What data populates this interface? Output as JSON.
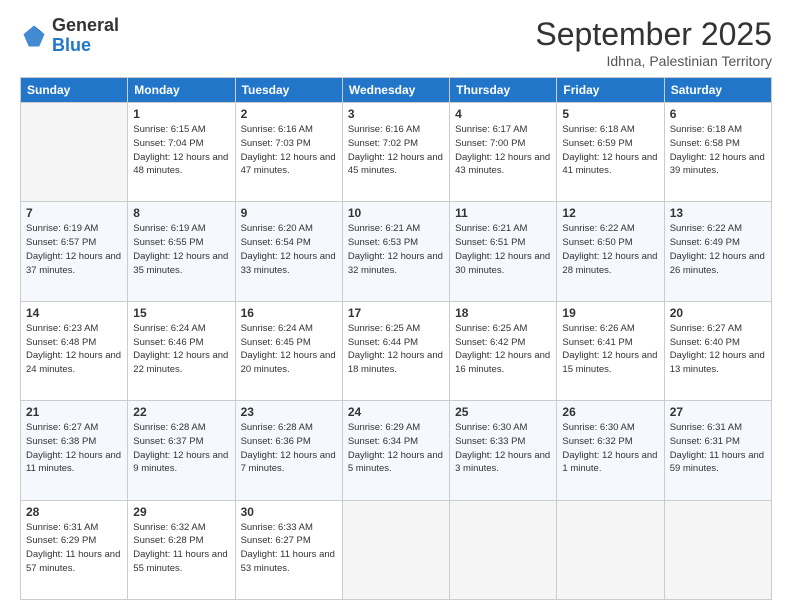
{
  "header": {
    "logo_general": "General",
    "logo_blue": "Blue",
    "month_title": "September 2025",
    "subtitle": "Idhna, Palestinian Territory"
  },
  "days_of_week": [
    "Sunday",
    "Monday",
    "Tuesday",
    "Wednesday",
    "Thursday",
    "Friday",
    "Saturday"
  ],
  "weeks": [
    [
      {
        "day": "",
        "sunrise": "",
        "sunset": "",
        "daylight": ""
      },
      {
        "day": "1",
        "sunrise": "Sunrise: 6:15 AM",
        "sunset": "Sunset: 7:04 PM",
        "daylight": "Daylight: 12 hours and 48 minutes."
      },
      {
        "day": "2",
        "sunrise": "Sunrise: 6:16 AM",
        "sunset": "Sunset: 7:03 PM",
        "daylight": "Daylight: 12 hours and 47 minutes."
      },
      {
        "day": "3",
        "sunrise": "Sunrise: 6:16 AM",
        "sunset": "Sunset: 7:02 PM",
        "daylight": "Daylight: 12 hours and 45 minutes."
      },
      {
        "day": "4",
        "sunrise": "Sunrise: 6:17 AM",
        "sunset": "Sunset: 7:00 PM",
        "daylight": "Daylight: 12 hours and 43 minutes."
      },
      {
        "day": "5",
        "sunrise": "Sunrise: 6:18 AM",
        "sunset": "Sunset: 6:59 PM",
        "daylight": "Daylight: 12 hours and 41 minutes."
      },
      {
        "day": "6",
        "sunrise": "Sunrise: 6:18 AM",
        "sunset": "Sunset: 6:58 PM",
        "daylight": "Daylight: 12 hours and 39 minutes."
      }
    ],
    [
      {
        "day": "7",
        "sunrise": "Sunrise: 6:19 AM",
        "sunset": "Sunset: 6:57 PM",
        "daylight": "Daylight: 12 hours and 37 minutes."
      },
      {
        "day": "8",
        "sunrise": "Sunrise: 6:19 AM",
        "sunset": "Sunset: 6:55 PM",
        "daylight": "Daylight: 12 hours and 35 minutes."
      },
      {
        "day": "9",
        "sunrise": "Sunrise: 6:20 AM",
        "sunset": "Sunset: 6:54 PM",
        "daylight": "Daylight: 12 hours and 33 minutes."
      },
      {
        "day": "10",
        "sunrise": "Sunrise: 6:21 AM",
        "sunset": "Sunset: 6:53 PM",
        "daylight": "Daylight: 12 hours and 32 minutes."
      },
      {
        "day": "11",
        "sunrise": "Sunrise: 6:21 AM",
        "sunset": "Sunset: 6:51 PM",
        "daylight": "Daylight: 12 hours and 30 minutes."
      },
      {
        "day": "12",
        "sunrise": "Sunrise: 6:22 AM",
        "sunset": "Sunset: 6:50 PM",
        "daylight": "Daylight: 12 hours and 28 minutes."
      },
      {
        "day": "13",
        "sunrise": "Sunrise: 6:22 AM",
        "sunset": "Sunset: 6:49 PM",
        "daylight": "Daylight: 12 hours and 26 minutes."
      }
    ],
    [
      {
        "day": "14",
        "sunrise": "Sunrise: 6:23 AM",
        "sunset": "Sunset: 6:48 PM",
        "daylight": "Daylight: 12 hours and 24 minutes."
      },
      {
        "day": "15",
        "sunrise": "Sunrise: 6:24 AM",
        "sunset": "Sunset: 6:46 PM",
        "daylight": "Daylight: 12 hours and 22 minutes."
      },
      {
        "day": "16",
        "sunrise": "Sunrise: 6:24 AM",
        "sunset": "Sunset: 6:45 PM",
        "daylight": "Daylight: 12 hours and 20 minutes."
      },
      {
        "day": "17",
        "sunrise": "Sunrise: 6:25 AM",
        "sunset": "Sunset: 6:44 PM",
        "daylight": "Daylight: 12 hours and 18 minutes."
      },
      {
        "day": "18",
        "sunrise": "Sunrise: 6:25 AM",
        "sunset": "Sunset: 6:42 PM",
        "daylight": "Daylight: 12 hours and 16 minutes."
      },
      {
        "day": "19",
        "sunrise": "Sunrise: 6:26 AM",
        "sunset": "Sunset: 6:41 PM",
        "daylight": "Daylight: 12 hours and 15 minutes."
      },
      {
        "day": "20",
        "sunrise": "Sunrise: 6:27 AM",
        "sunset": "Sunset: 6:40 PM",
        "daylight": "Daylight: 12 hours and 13 minutes."
      }
    ],
    [
      {
        "day": "21",
        "sunrise": "Sunrise: 6:27 AM",
        "sunset": "Sunset: 6:38 PM",
        "daylight": "Daylight: 12 hours and 11 minutes."
      },
      {
        "day": "22",
        "sunrise": "Sunrise: 6:28 AM",
        "sunset": "Sunset: 6:37 PM",
        "daylight": "Daylight: 12 hours and 9 minutes."
      },
      {
        "day": "23",
        "sunrise": "Sunrise: 6:28 AM",
        "sunset": "Sunset: 6:36 PM",
        "daylight": "Daylight: 12 hours and 7 minutes."
      },
      {
        "day": "24",
        "sunrise": "Sunrise: 6:29 AM",
        "sunset": "Sunset: 6:34 PM",
        "daylight": "Daylight: 12 hours and 5 minutes."
      },
      {
        "day": "25",
        "sunrise": "Sunrise: 6:30 AM",
        "sunset": "Sunset: 6:33 PM",
        "daylight": "Daylight: 12 hours and 3 minutes."
      },
      {
        "day": "26",
        "sunrise": "Sunrise: 6:30 AM",
        "sunset": "Sunset: 6:32 PM",
        "daylight": "Daylight: 12 hours and 1 minute."
      },
      {
        "day": "27",
        "sunrise": "Sunrise: 6:31 AM",
        "sunset": "Sunset: 6:31 PM",
        "daylight": "Daylight: 11 hours and 59 minutes."
      }
    ],
    [
      {
        "day": "28",
        "sunrise": "Sunrise: 6:31 AM",
        "sunset": "Sunset: 6:29 PM",
        "daylight": "Daylight: 11 hours and 57 minutes."
      },
      {
        "day": "29",
        "sunrise": "Sunrise: 6:32 AM",
        "sunset": "Sunset: 6:28 PM",
        "daylight": "Daylight: 11 hours and 55 minutes."
      },
      {
        "day": "30",
        "sunrise": "Sunrise: 6:33 AM",
        "sunset": "Sunset: 6:27 PM",
        "daylight": "Daylight: 11 hours and 53 minutes."
      },
      {
        "day": "",
        "sunrise": "",
        "sunset": "",
        "daylight": ""
      },
      {
        "day": "",
        "sunrise": "",
        "sunset": "",
        "daylight": ""
      },
      {
        "day": "",
        "sunrise": "",
        "sunset": "",
        "daylight": ""
      },
      {
        "day": "",
        "sunrise": "",
        "sunset": "",
        "daylight": ""
      }
    ]
  ]
}
